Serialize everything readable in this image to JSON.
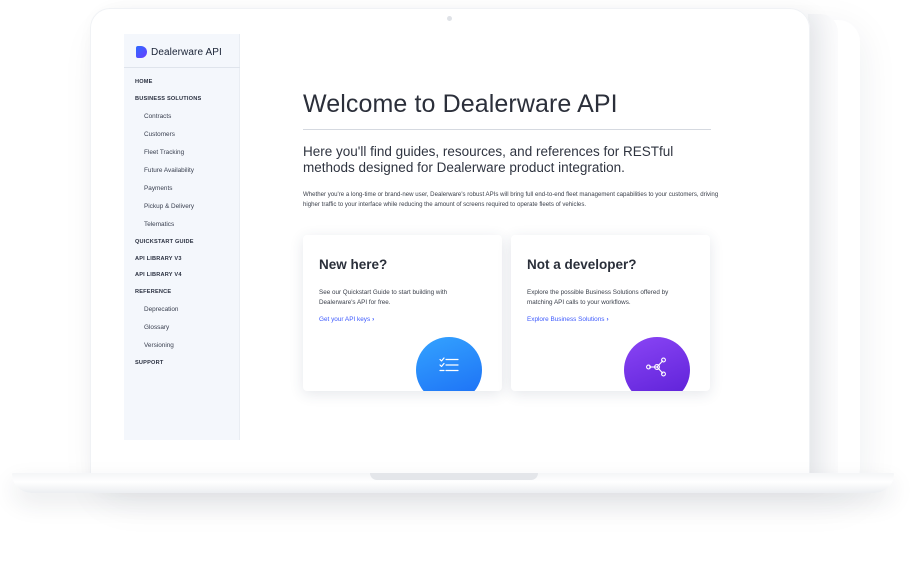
{
  "brand": {
    "name": "Dealerware API"
  },
  "sidebar": {
    "items": [
      {
        "label": "HOME",
        "type": "section"
      },
      {
        "label": "BUSINESS SOLUTIONS",
        "type": "section"
      },
      {
        "label": "Contracts",
        "type": "sub"
      },
      {
        "label": "Customers",
        "type": "sub"
      },
      {
        "label": "Fleet Tracking",
        "type": "sub"
      },
      {
        "label": "Future Availability",
        "type": "sub"
      },
      {
        "label": "Payments",
        "type": "sub"
      },
      {
        "label": "Pickup & Delivery",
        "type": "sub"
      },
      {
        "label": "Telematics",
        "type": "sub"
      },
      {
        "label": "QUICKSTART GUIDE",
        "type": "section"
      },
      {
        "label": "API LIBRARY V3",
        "type": "section"
      },
      {
        "label": "API LIBRARY V4",
        "type": "section"
      },
      {
        "label": "REFERENCE",
        "type": "section"
      },
      {
        "label": "Deprecation",
        "type": "sub"
      },
      {
        "label": "Glossary",
        "type": "sub"
      },
      {
        "label": "Versioning",
        "type": "sub"
      },
      {
        "label": "SUPPORT",
        "type": "section"
      }
    ]
  },
  "main": {
    "title": "Welcome to Dealerware API",
    "lead": "Here you'll find guides, resources, and references for RESTful methods designed for Dealerware product integration.",
    "body": "Whether you're a long-time or brand-new user, Dealerware's robust APIs will bring full end-to-end fleet management capabilities to your customers, driving higher traffic to your interface while reducing the amount of screens required to operate fleets of vehicles.",
    "cards": [
      {
        "title": "New here?",
        "text": "See our Quickstart Guide to start building with Dealerware's API for free.",
        "link": "Get your API keys",
        "icon": "checklist-icon"
      },
      {
        "title": "Not a developer?",
        "text": "Explore the possible Business Solutions offered by matching API calls to your workflows.",
        "link": "Explore Business Solutions",
        "icon": "network-icon"
      }
    ]
  },
  "colors": {
    "accent_link": "#3d5afe",
    "card_icon_blue": "#1b6df5",
    "card_icon_purple": "#6a2ae0",
    "sidebar_bg": "#f4f7fc"
  }
}
